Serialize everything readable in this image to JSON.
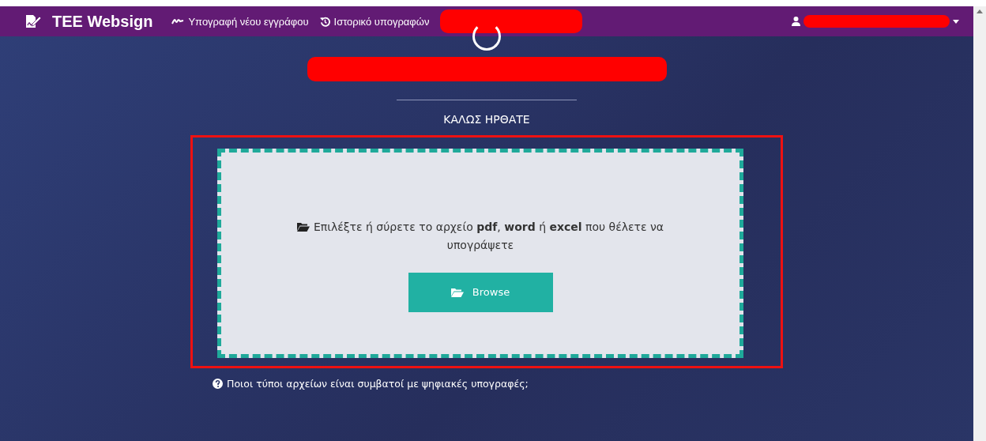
{
  "navbar": {
    "brand": "TEE Websign",
    "links": [
      {
        "kind": "sign",
        "label": "Υπογραφή νέου εγγράφου"
      },
      {
        "kind": "history",
        "label": "Ιστορικό υπογραφών"
      }
    ]
  },
  "welcome": "ΚΑΛΩΣ ΗΡΘΑΤΕ",
  "upload": {
    "message": "Επιλέξτε ή σύρετε το αρχείο **pdf**, **word** ή **excel** που θέλετε να υπογράψετε",
    "button": "Browse"
  },
  "help_link": "Ποιοι τύποι αρχείων είναι συμβατοί με ψηφιακές υπογραφές;"
}
